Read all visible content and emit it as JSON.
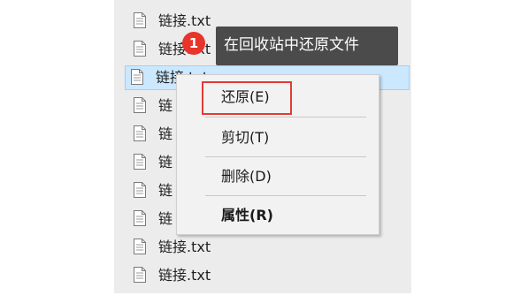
{
  "file_list": {
    "items": [
      {
        "name": "链接.txt",
        "icon": "text-file-icon",
        "selected": false
      },
      {
        "name": "链接.txt",
        "icon": "text-file-icon",
        "selected": false
      },
      {
        "name": "链接.txt",
        "icon": "text-file-icon",
        "selected": true
      },
      {
        "name": "链",
        "icon": "text-file-icon",
        "selected": false
      },
      {
        "name": "链",
        "icon": "text-file-icon",
        "selected": false
      },
      {
        "name": "链",
        "icon": "text-file-icon",
        "selected": false
      },
      {
        "name": "链",
        "icon": "text-file-icon",
        "selected": false
      },
      {
        "name": "链",
        "icon": "text-file-icon",
        "selected": false
      },
      {
        "name": "链接.txt",
        "icon": "text-file-icon",
        "selected": false
      },
      {
        "name": "链接.txt",
        "icon": "text-file-icon",
        "selected": false
      }
    ]
  },
  "callout": {
    "step_number": "1",
    "text": "在回收站中还原文件",
    "badge_color": "#e8342a",
    "tooltip_color": "#4b4b4b"
  },
  "context_menu": {
    "restore_label": "还原(E)",
    "cut_label": "剪切(T)",
    "delete_label": "删除(D)",
    "properties_label": "属性(R)",
    "highlight_color": "#e53a33"
  },
  "colors": {
    "selection_bg": "#cce8ff",
    "selection_border": "#99d1ff",
    "pane_bg": "#ececec"
  }
}
